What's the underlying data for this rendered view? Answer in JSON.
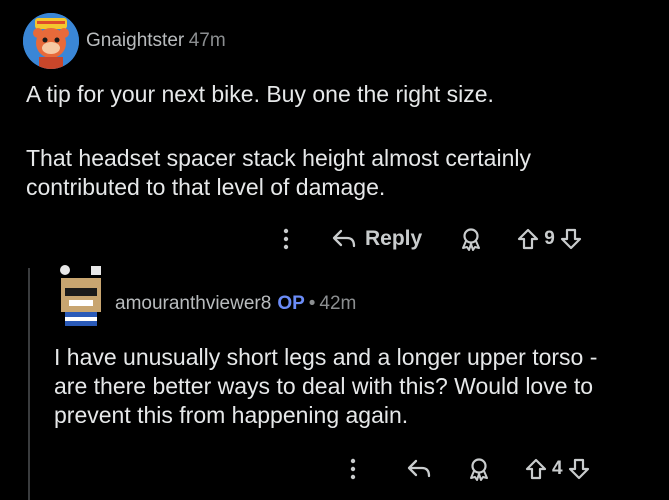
{
  "comments": [
    {
      "username": "Gnaightster",
      "time": "47m",
      "body_p1": "A tip for your next bike. Buy one the right size.",
      "body_p2": "That headset spacer stack height almost certainly\ncontributed to that level of damage.",
      "actions": {
        "more_icon": "more-vertical-icon",
        "reply_label": "Reply",
        "award_icon": "award-icon",
        "upvote_icon": "arrow-up-icon",
        "vote_count": "9",
        "downvote_icon": "arrow-down-icon"
      }
    },
    {
      "username": "amouranthviewer8",
      "op_badge": "OP",
      "separator": "•",
      "time": "42m",
      "body_p1": "I have unusually short legs and a longer upper torso -\nare there better ways to deal with this? Would love to\nprevent this from happening again.",
      "actions": {
        "more_icon": "more-vertical-icon",
        "reply_icon": "reply-arrow-icon",
        "award_icon": "award-icon",
        "upvote_icon": "arrow-up-icon",
        "vote_count": "4",
        "downvote_icon": "arrow-down-icon"
      }
    }
  ],
  "colors": {
    "background": "#000000",
    "text": "#e6e8e9",
    "op_badge": "#6b8cf7",
    "thread_line": "#3a3c3e"
  }
}
